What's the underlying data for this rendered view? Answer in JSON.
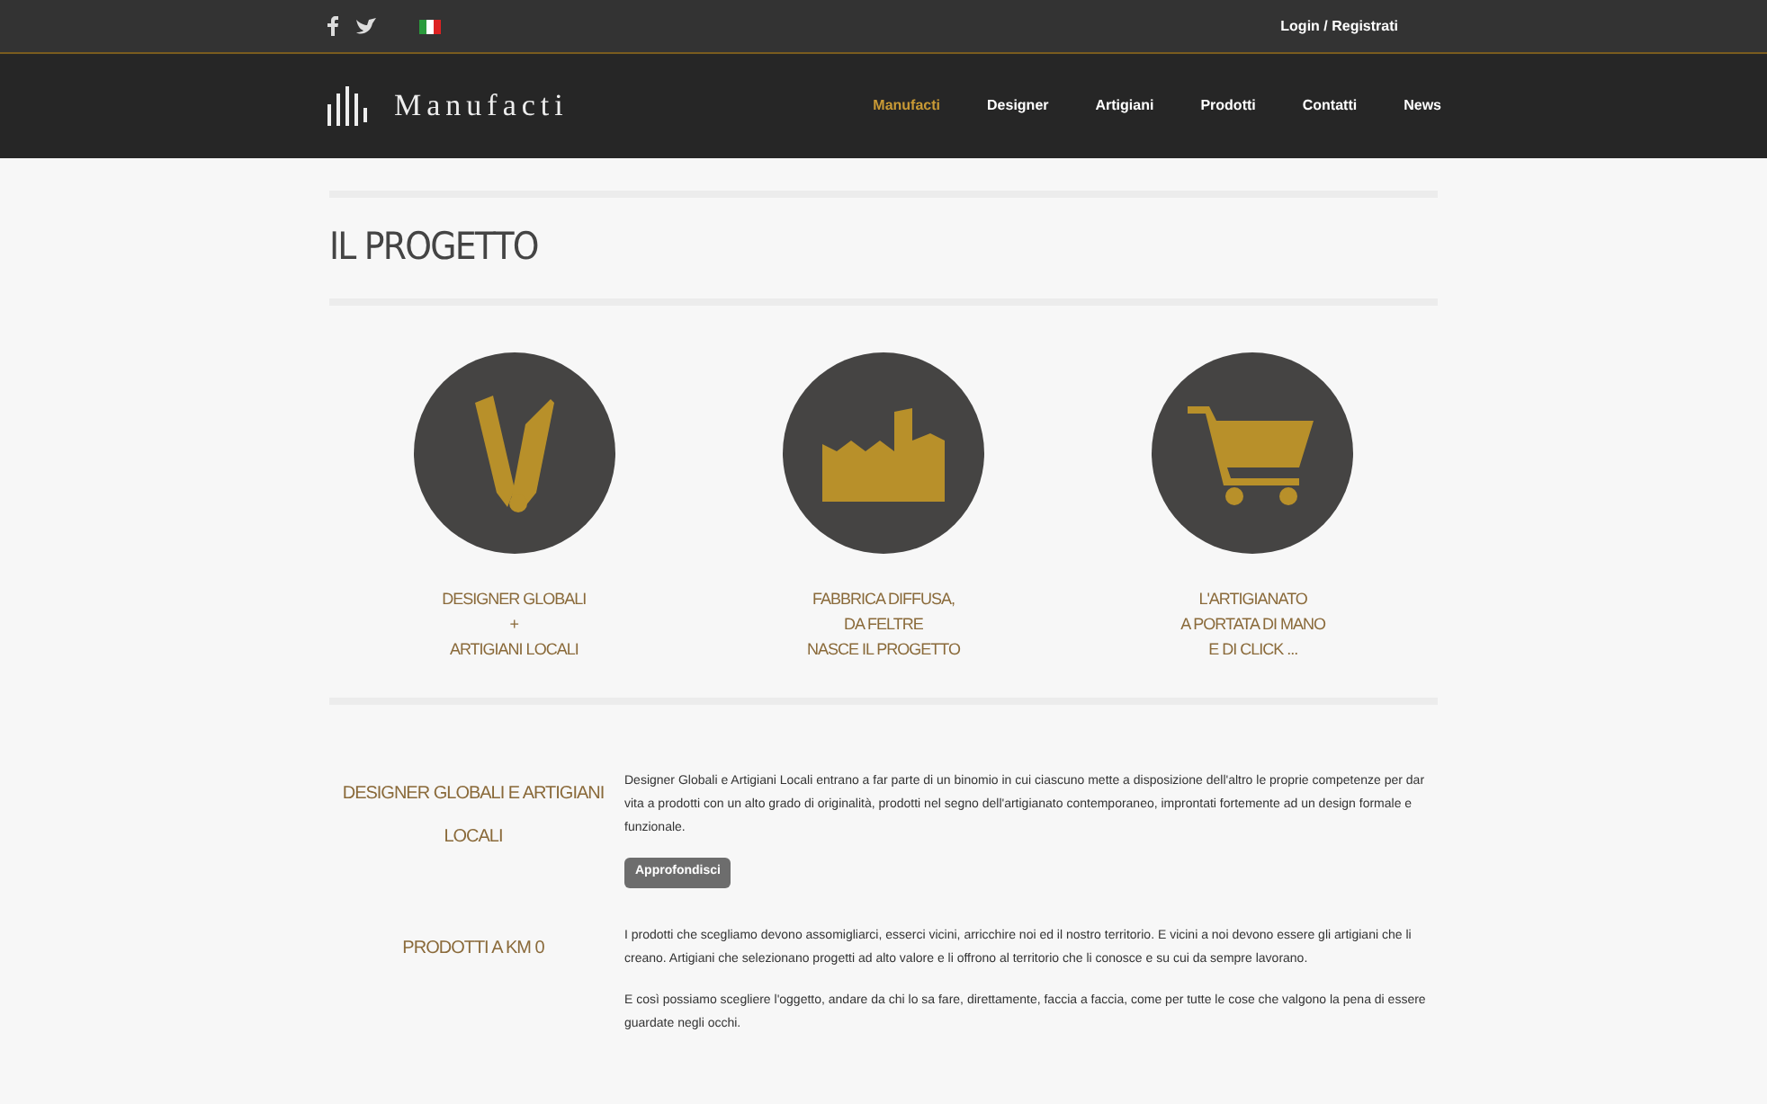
{
  "topbar": {
    "login": "Login / Registrati"
  },
  "nav": {
    "logo": "Manufacti",
    "items": [
      {
        "label": "Manufacti",
        "selected": true
      },
      {
        "label": "Designer",
        "selected": false
      },
      {
        "label": "Artigiani",
        "selected": false
      },
      {
        "label": "Prodotti",
        "selected": false
      },
      {
        "label": "Contatti",
        "selected": false
      },
      {
        "label": "News",
        "selected": false
      }
    ]
  },
  "title": "IL PROGETTO",
  "features": [
    {
      "kind": "tools",
      "lines": [
        "DESIGNER GLOBALI",
        "+",
        "ARTIGIANI LOCALI"
      ]
    },
    {
      "kind": "factory",
      "lines": [
        "FABBRICA DIFFUSA,",
        "DA FELTRE",
        "NASCE IL PROGETTO"
      ]
    },
    {
      "kind": "cart",
      "lines": [
        "L'ARTIGIANATO",
        "A PORTATA DI MANO",
        "E DI CLICK ..."
      ]
    }
  ],
  "sections": [
    {
      "heading": "DESIGNER GLOBALI E ARTIGIANI LOCALI",
      "paragraphs": [
        "Designer Globali e Artigiani Locali entrano a far parte di un binomio in cui ciascuno mette a disposizione dell'altro le proprie competenze per dar vita a prodotti con un alto grado di originalità, prodotti nel segno dell'artigianato contemporaneo, improntati fortemente ad un design formale e funzionale."
      ],
      "button": "Approfondisci"
    },
    {
      "heading": "PRODOTTI A KM 0",
      "paragraphs": [
        "I prodotti che scegliamo devono assomigliarci, esserci vicini, arricchire noi ed il nostro territorio. E vicini a noi devono essere gli artigiani che li creano. Artigiani che selezionano progetti ad alto valore e li offrono al territorio che li conosce e su cui da sempre lavorano.",
        "E così possiamo scegliere l'oggetto, andare da chi lo sa fare, direttamente, faccia a faccia, come per tutte le cose che valgono la pena di essere guardate negli occhi."
      ]
    }
  ]
}
